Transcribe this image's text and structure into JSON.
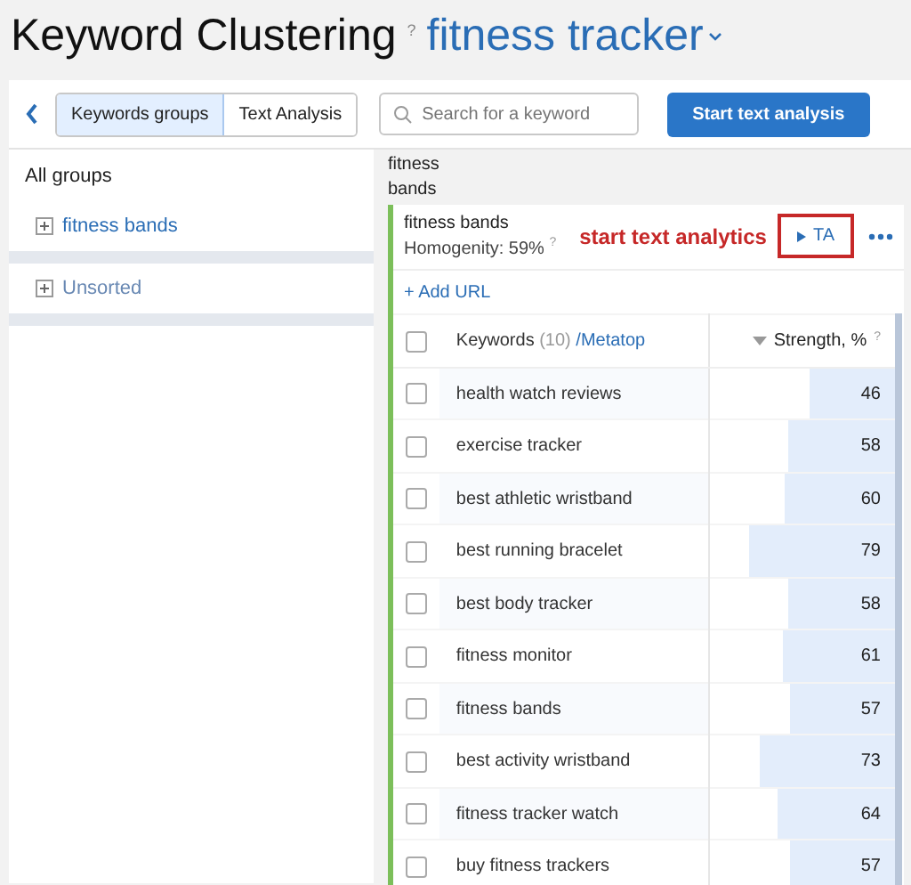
{
  "header": {
    "title": "Keyword Clustering",
    "help": "?",
    "project": "fitness tracker"
  },
  "toolbar": {
    "tabs": [
      {
        "label": "Keywords groups",
        "selected": true
      },
      {
        "label": "Text Analysis",
        "selected": false
      }
    ],
    "search": {
      "placeholder": "Search for a keyword"
    },
    "action": "Start text analysis"
  },
  "sidebar": {
    "title": "All groups",
    "items": [
      {
        "label": "fitness bands",
        "selected": true
      },
      {
        "label": "Unsorted",
        "selected": false
      }
    ]
  },
  "breadcrumb": "fitness bands",
  "group": {
    "name": "fitness bands",
    "homogeneity": "Homogenity: 59%",
    "help": "?",
    "annotation": "start text analytics",
    "ta_button": {
      "label": "TA",
      "highlighted": true
    },
    "add_url": "+ Add URL",
    "table": {
      "all_checked": false,
      "columns": {
        "keywords": "Keywords",
        "count": "(10)",
        "metatop": "/Metatop",
        "strength": "Strength, %",
        "help": "?"
      },
      "rows": [
        {
          "keyword": "health watch reviews",
          "strength": "46",
          "level": 0.46,
          "checked": false
        },
        {
          "keyword": "exercise tracker",
          "strength": "58",
          "level": 0.58,
          "checked": false
        },
        {
          "keyword": "best athletic wristband",
          "strength": "60",
          "level": 0.6,
          "checked": false
        },
        {
          "keyword": "best running bracelet",
          "strength": "79",
          "level": 0.79,
          "checked": false
        },
        {
          "keyword": "best body tracker",
          "strength": "58",
          "level": 0.58,
          "checked": false
        },
        {
          "keyword": "fitness monitor",
          "strength": "61",
          "level": 0.61,
          "checked": false
        },
        {
          "keyword": "fitness bands",
          "strength": "57",
          "level": 0.57,
          "checked": false
        },
        {
          "keyword": "best activity wristband",
          "strength": "73",
          "level": 0.73,
          "checked": false
        },
        {
          "keyword": "fitness tracker watch",
          "strength": "64",
          "level": 0.64,
          "checked": false
        },
        {
          "keyword": "buy fitness trackers",
          "strength": "57",
          "level": 0.57,
          "checked": false
        }
      ]
    }
  }
}
